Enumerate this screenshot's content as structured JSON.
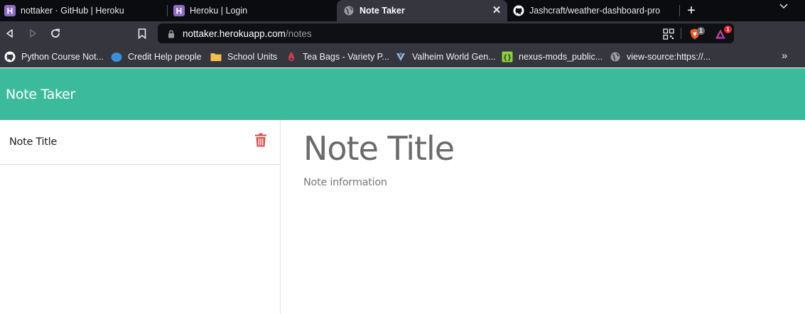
{
  "browser": {
    "tabs": [
      {
        "title": "nottaker · GitHub | Heroku",
        "icon": "heroku-icon",
        "active": false
      },
      {
        "title": "Heroku | Login",
        "icon": "heroku-icon",
        "active": false
      },
      {
        "title": "Note Taker",
        "icon": "globe-icon",
        "active": true
      },
      {
        "title": "Jashcraft/weather-dashboard-pro",
        "icon": "github-icon",
        "active": false
      }
    ],
    "close_glyph": "✕",
    "new_tab_glyph": "+",
    "url_host": "nottaker.herokuapp.com",
    "url_path": "/notes",
    "brave_badge": "1",
    "rewards_badge": "1",
    "bookmarks": [
      {
        "label": "Python Course Not...",
        "icon": "github-icon"
      },
      {
        "label": "Credit Help people",
        "icon": "blue-blob-icon"
      },
      {
        "label": "School Units",
        "icon": "folder-icon"
      },
      {
        "label": "Tea Bags - Variety P...",
        "icon": "tea-icon"
      },
      {
        "label": "Valheim World Gen...",
        "icon": "valheim-icon"
      },
      {
        "label": "nexus-mods_public...",
        "icon": "nexus-icon"
      },
      {
        "label": "view-source:https://...",
        "icon": "globe-icon"
      }
    ],
    "bookmarks_more": "»"
  },
  "app": {
    "title": "Note Taker",
    "accent": "#3cbb9c",
    "notes": [
      {
        "title": "Note Title"
      }
    ],
    "editor": {
      "title_placeholder": "Note Title",
      "text_placeholder": "Note information"
    }
  }
}
